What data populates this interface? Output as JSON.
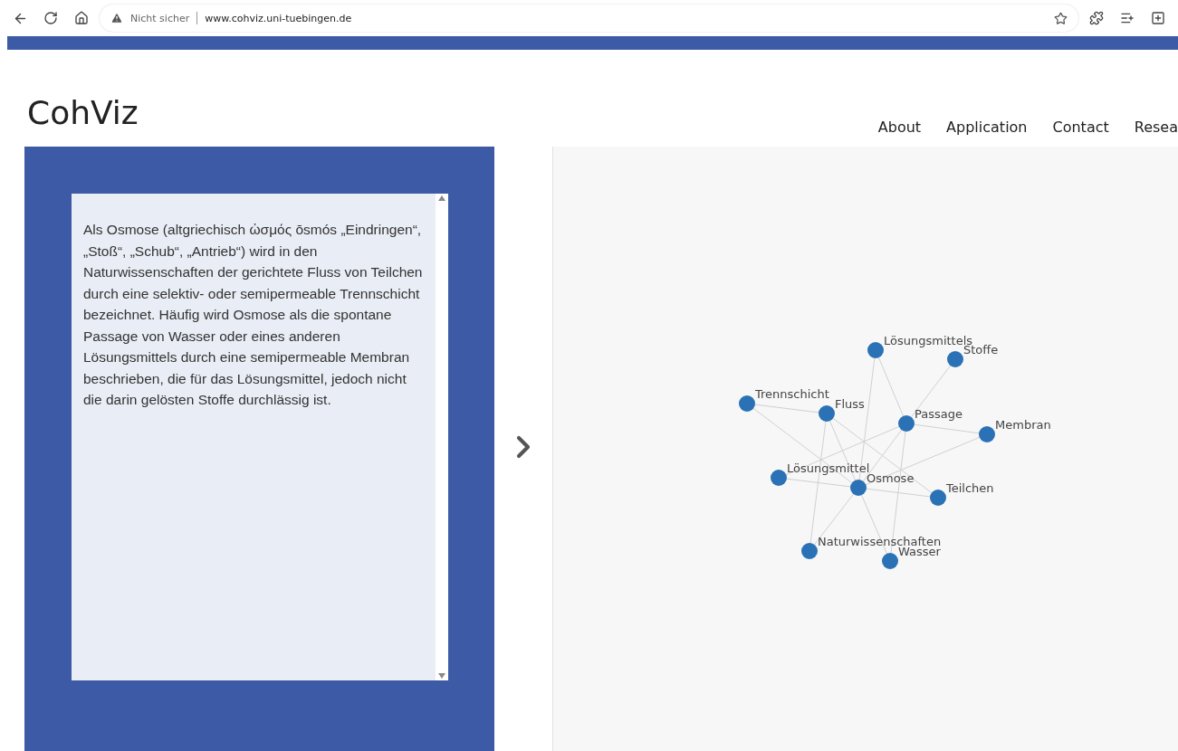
{
  "browser": {
    "security_label": "Nicht sicher",
    "url": "www.cohviz.uni-tuebingen.de"
  },
  "site": {
    "title": "CohViz",
    "nav": [
      {
        "label": "About"
      },
      {
        "label": "Application"
      },
      {
        "label": "Contact"
      },
      {
        "label": "Resea"
      }
    ]
  },
  "text_panel": {
    "text": "Als Osmose (altgriechisch ὠσμός ōsmós „Eindringen“, „Stoß“, „Schub“, „Antrieb“) wird in den Naturwissenschaften der gerichtete Fluss von Teilchen durch eine selektiv- oder semipermeable Trennschicht bezeichnet. Häufig wird Osmose als die spontane Passage von Wasser oder eines anderen Lösungsmittels durch eine semipermeable Membran beschrieben, die für das Lösungsmittel, jedoch nicht die darin gelösten Stoffe durchlässig ist."
  },
  "graph": {
    "nodes": [
      {
        "label": "Lösungsmittels"
      },
      {
        "label": "Stoffe"
      },
      {
        "label": "Trennschicht"
      },
      {
        "label": "Fluss"
      },
      {
        "label": "Passage"
      },
      {
        "label": "Membran"
      },
      {
        "label": "Lösungsmittel"
      },
      {
        "label": "Osmose"
      },
      {
        "label": "Teilchen"
      },
      {
        "label": "Naturwissenschaften"
      },
      {
        "label": "Wasser"
      }
    ]
  }
}
